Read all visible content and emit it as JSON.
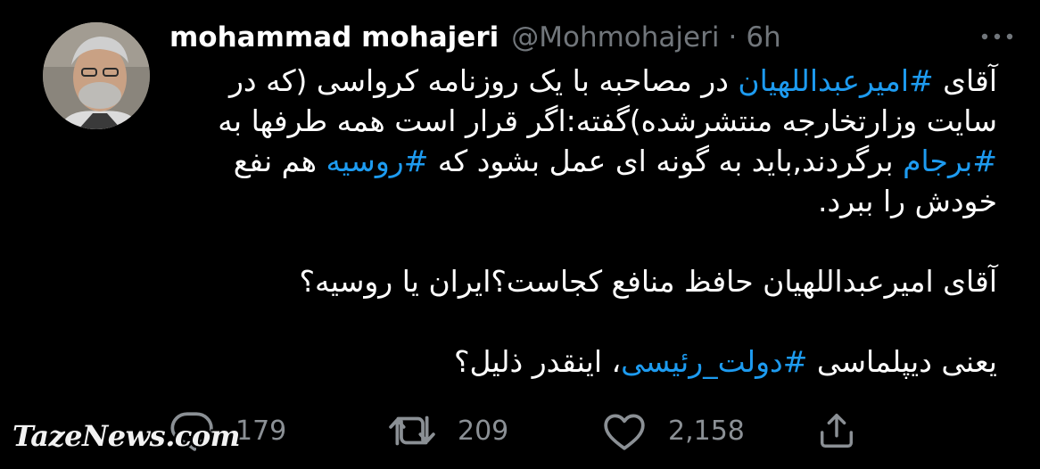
{
  "tweet": {
    "author_name": "mohammad mohajeri",
    "handle": "@Mohmohajeri",
    "separator": "·",
    "time": "6h",
    "paragraph1": {
      "t1": "آقای ",
      "h1": "#امیرعبداللهیان",
      "t2": " در مصاحبه با یک روزنامه کرواسی (که در سایت وزارتخارجه منتشرشده)گفته:اگر قرار است همه طرفها به ",
      "h2": "#برجام",
      "t3": " برگردند,باید به گونه ای عمل بشود که ",
      "h3": "#روسیه",
      "t4": " هم نفع خودش را ببرد."
    },
    "paragraph2": "آقای امیرعبداللهیان حافظ منافع کجاست؟ایران یا روسیه؟",
    "paragraph3": {
      "t1": "یعنی دیپلماسی ",
      "h1": "#دولت_رئیسی",
      "t2": "، اینقدر ذلیل؟"
    }
  },
  "actions": {
    "reply_count": "179",
    "retweet_count": "209",
    "like_count": "2,158"
  },
  "icons": {
    "more": "more-horizontal-icon",
    "reply": "reply-icon",
    "retweet": "retweet-icon",
    "like": "heart-icon",
    "share": "share-icon"
  },
  "colors": {
    "background": "#000000",
    "text": "#ffffff",
    "muted": "#71767b",
    "hashtag": "#1d9bf0"
  },
  "watermark": "TazeNews.com"
}
